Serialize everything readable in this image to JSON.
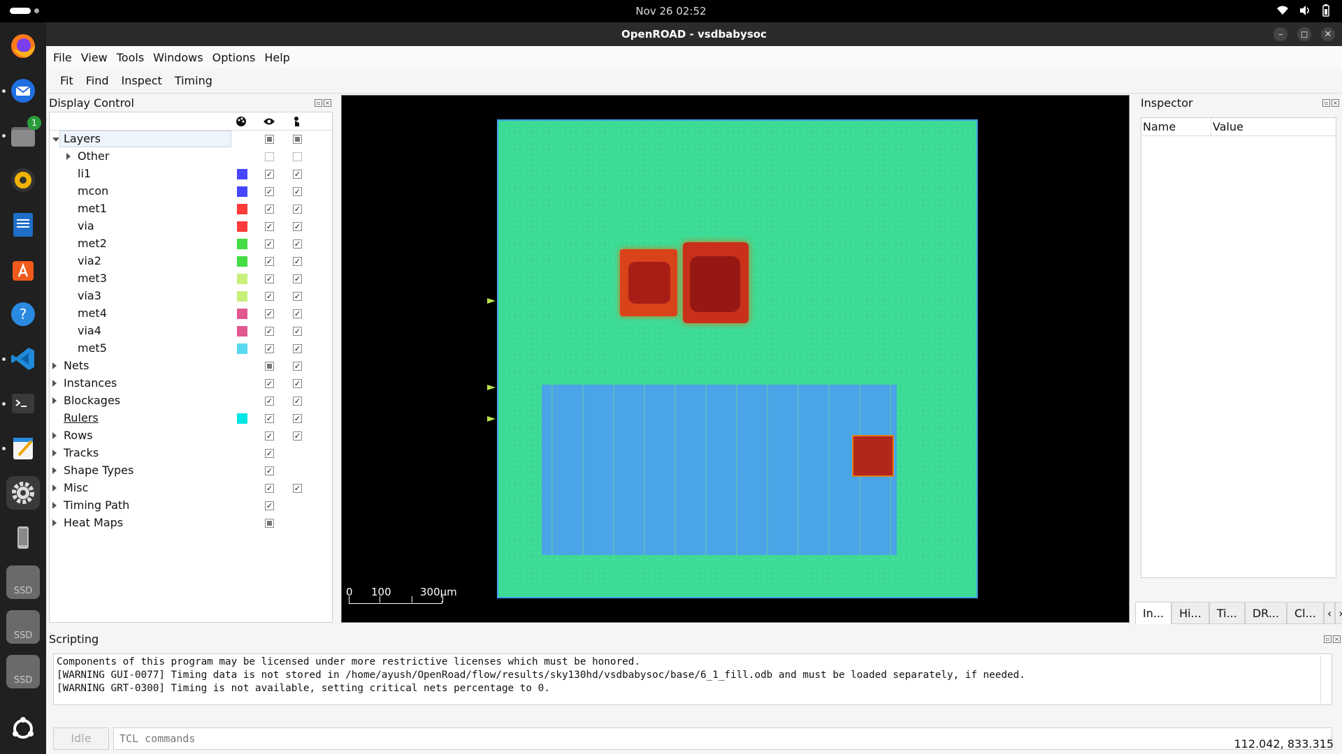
{
  "system": {
    "clock": "Nov 26  02:52",
    "dock_items": [
      "firefox-icon",
      "thunderbird-icon",
      "files-icon",
      "rhythmbox-icon",
      "writer-icon",
      "app-center-icon",
      "help-icon",
      "vscode-icon",
      "terminal-icon",
      "text-editor-icon",
      "settings-icon",
      "phone-icon",
      "ssd-drive-icon",
      "ssd-drive-icon",
      "ssd-drive-icon",
      "show-apps-icon"
    ],
    "files_badge": "1",
    "ssd_label": "SSD"
  },
  "window": {
    "title": "OpenROAD - vsdbabysoc",
    "controls": [
      "–",
      "◻",
      "✕"
    ]
  },
  "menubar": [
    "File",
    "View",
    "Tools",
    "Windows",
    "Options",
    "Help"
  ],
  "toolbar": [
    "Fit",
    "Find",
    "Inspect",
    "Timing"
  ],
  "display_control": {
    "title": "Display Control",
    "header_icons": [
      "palette-icon",
      "eye-icon",
      "pointer-icon"
    ],
    "rows": [
      {
        "label": "Layers",
        "indent": 0,
        "expand": "down",
        "color": null,
        "visible": "partial",
        "select": "partial",
        "selected": true
      },
      {
        "label": "Other",
        "indent": 1,
        "expand": "right",
        "color": null,
        "visible": "off",
        "select": "off"
      },
      {
        "label": "li1",
        "indent": 1,
        "expand": "none",
        "color": "#4646ff",
        "visible": "on",
        "select": "on"
      },
      {
        "label": "mcon",
        "indent": 1,
        "expand": "none",
        "color": "#4646ff",
        "visible": "on",
        "select": "on"
      },
      {
        "label": "met1",
        "indent": 1,
        "expand": "none",
        "color": "#ff3a3a",
        "visible": "on",
        "select": "on"
      },
      {
        "label": "via",
        "indent": 1,
        "expand": "none",
        "color": "#ff3a3a",
        "visible": "on",
        "select": "on"
      },
      {
        "label": "met2",
        "indent": 1,
        "expand": "none",
        "color": "#44dd44",
        "visible": "on",
        "select": "on"
      },
      {
        "label": "via2",
        "indent": 1,
        "expand": "none",
        "color": "#44dd44",
        "visible": "on",
        "select": "on"
      },
      {
        "label": "met3",
        "indent": 1,
        "expand": "none",
        "color": "#c8f07a",
        "visible": "on",
        "select": "on"
      },
      {
        "label": "via3",
        "indent": 1,
        "expand": "none",
        "color": "#c8f07a",
        "visible": "on",
        "select": "on"
      },
      {
        "label": "met4",
        "indent": 1,
        "expand": "none",
        "color": "#e25890",
        "visible": "on",
        "select": "on"
      },
      {
        "label": "via4",
        "indent": 1,
        "expand": "none",
        "color": "#e25890",
        "visible": "on",
        "select": "on"
      },
      {
        "label": "met5",
        "indent": 1,
        "expand": "none",
        "color": "#5ad8f0",
        "visible": "on",
        "select": "on"
      },
      {
        "label": "Nets",
        "indent": 0,
        "expand": "right",
        "color": null,
        "visible": "partial",
        "select": "on"
      },
      {
        "label": "Instances",
        "indent": 0,
        "expand": "right",
        "color": null,
        "visible": "on",
        "select": "on"
      },
      {
        "label": "Blockages",
        "indent": 0,
        "expand": "right",
        "color": null,
        "visible": "on",
        "select": "on"
      },
      {
        "label": "Rulers",
        "indent": 0,
        "expand": "none",
        "color": "#00e5e5",
        "visible": "on",
        "select": "on",
        "underline": true
      },
      {
        "label": "Rows",
        "indent": 0,
        "expand": "right",
        "color": null,
        "visible": "on",
        "select": "on"
      },
      {
        "label": "Tracks",
        "indent": 0,
        "expand": "right",
        "color": null,
        "visible": "on",
        "select": "none"
      },
      {
        "label": "Shape Types",
        "indent": 0,
        "expand": "right",
        "color": null,
        "visible": "on",
        "select": "none"
      },
      {
        "label": "Misc",
        "indent": 0,
        "expand": "right",
        "color": null,
        "visible": "on",
        "select": "on"
      },
      {
        "label": "Timing Path",
        "indent": 0,
        "expand": "right",
        "color": null,
        "visible": "on",
        "select": "none"
      },
      {
        "label": "Heat Maps",
        "indent": 0,
        "expand": "right",
        "color": null,
        "visible": "partial",
        "select": "none"
      }
    ]
  },
  "layout_view": {
    "scale_labels": [
      "0",
      "100",
      "300µm"
    ],
    "die_color": "#3cdb95",
    "core_color": "#4aa4e6",
    "hotspot_color": "#c8301a"
  },
  "inspector": {
    "title": "Inspector",
    "columns": [
      "Name",
      "Value"
    ],
    "tabs": [
      "In...",
      "Hi...",
      "Ti...",
      "DR...",
      "Cl..."
    ]
  },
  "scripting": {
    "title": "Scripting",
    "log": [
      "Components of this program may be licensed under more restrictive licenses which must be honored.",
      "[WARNING GUI-0077] Timing data is not stored in /home/ayush/OpenRoad/flow/results/sky130hd/vsdbabysoc/base/6_1_fill.odb and must be loaded separately, if needed.",
      "[WARNING GRT-0300] Timing is not available, setting critical nets percentage to 0."
    ],
    "status": "Idle",
    "input_placeholder": "TCL commands"
  },
  "status_bar": {
    "coordinates": "112.042, 833.315"
  }
}
